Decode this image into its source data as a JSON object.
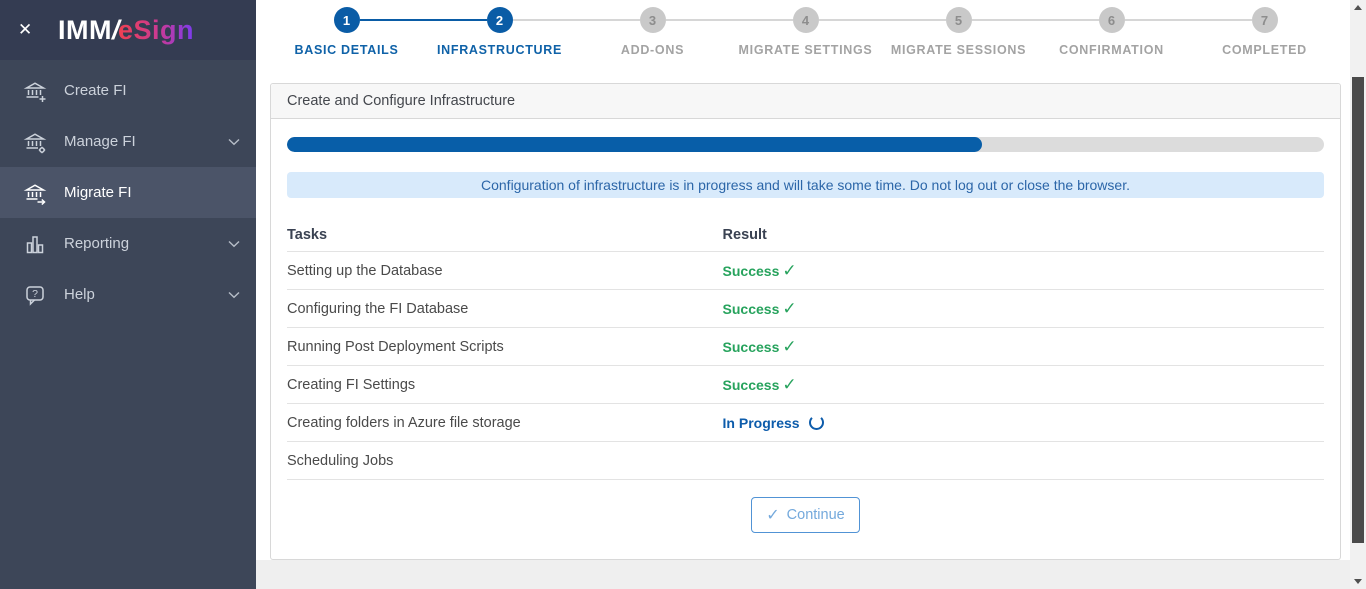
{
  "brand": {
    "name_left": "IMM",
    "slash": "/",
    "name_right": "eSign"
  },
  "icons": {
    "close": "✕",
    "check": "✓"
  },
  "sidebar": {
    "items": [
      {
        "label": "Create FI",
        "icon": "bank-plus-icon",
        "expandable": false,
        "active": false
      },
      {
        "label": "Manage FI",
        "icon": "bank-gear-icon",
        "expandable": true,
        "active": false
      },
      {
        "label": "Migrate FI",
        "icon": "bank-arrow-icon",
        "expandable": false,
        "active": true
      },
      {
        "label": "Reporting",
        "icon": "bar-chart-icon",
        "expandable": true,
        "active": false
      },
      {
        "label": "Help",
        "icon": "help-bubble-icon",
        "expandable": true,
        "active": false
      }
    ]
  },
  "stepper": {
    "steps": [
      {
        "num": "1",
        "label": "BASIC DETAILS",
        "state": "complete"
      },
      {
        "num": "2",
        "label": "INFRASTRUCTURE",
        "state": "active"
      },
      {
        "num": "3",
        "label": "ADD-ONS",
        "state": "upcoming"
      },
      {
        "num": "4",
        "label": "MIGRATE SETTINGS",
        "state": "upcoming"
      },
      {
        "num": "5",
        "label": "MIGRATE SESSIONS",
        "state": "upcoming"
      },
      {
        "num": "6",
        "label": "CONFIRMATION",
        "state": "upcoming"
      },
      {
        "num": "7",
        "label": "COMPLETED",
        "state": "upcoming"
      }
    ]
  },
  "panel": {
    "title": "Create and Configure Infrastructure",
    "progress_percent": 67,
    "banner_text": "Configuration of infrastructure is in progress and will take some time. Do not log out or close the browser.",
    "table": {
      "headers": {
        "tasks": "Tasks",
        "result": "Result"
      },
      "rows": [
        {
          "task": "Setting up the Database",
          "result": "Success",
          "status": "success"
        },
        {
          "task": "Configuring the FI Database",
          "result": "Success",
          "status": "success"
        },
        {
          "task": "Running Post Deployment Scripts",
          "result": "Success",
          "status": "success"
        },
        {
          "task": "Creating FI Settings",
          "result": "Success",
          "status": "success"
        },
        {
          "task": "Creating folders in Azure file storage",
          "result": "In Progress",
          "status": "in-progress"
        },
        {
          "task": "Scheduling Jobs",
          "result": "",
          "status": "pending"
        }
      ]
    },
    "continue_button": "Continue"
  },
  "colors": {
    "accent_blue": "#0a5ca6",
    "success_green": "#27a35d",
    "banner_bg": "#d8eafb",
    "banner_text": "#2c66a8",
    "sidebar_bg": "#3d4658",
    "sidebar_header_bg": "#343c52"
  }
}
